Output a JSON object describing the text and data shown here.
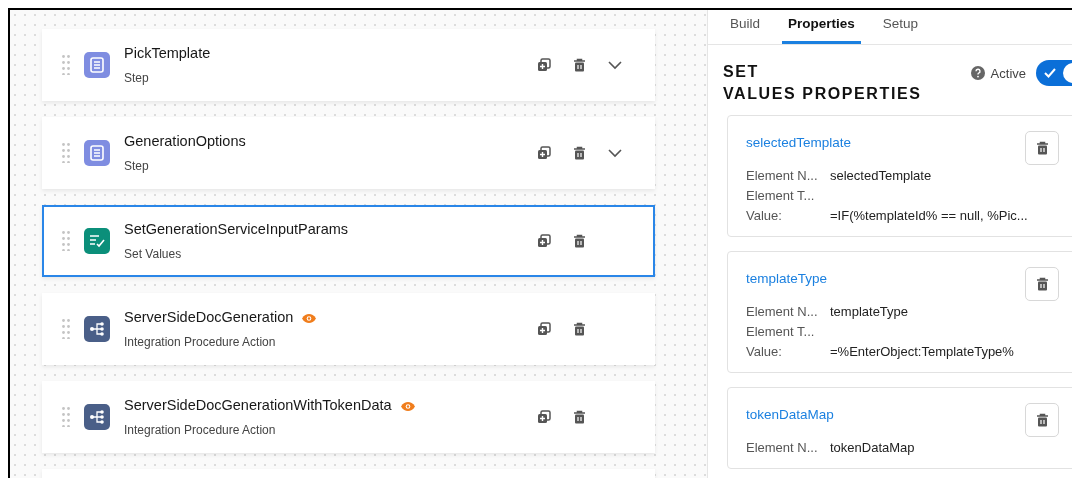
{
  "steps": [
    {
      "kind": "step",
      "title": "PickTemplate",
      "subtitle": "Step",
      "selected": false
    },
    {
      "kind": "step",
      "title": "GenerationOptions",
      "subtitle": "Step",
      "selected": false
    },
    {
      "kind": "set-values",
      "title": "SetGenerationServiceInputParams",
      "subtitle": "Set Values",
      "selected": true
    },
    {
      "kind": "integration-procedure",
      "title": "ServerSideDocGeneration",
      "subtitle": "Integration Procedure Action",
      "selected": false
    },
    {
      "kind": "integration-procedure",
      "title": "ServerSideDocGenerationWithTokenData",
      "subtitle": "Integration Procedure Action",
      "selected": false
    }
  ],
  "tabs": [
    {
      "label": "Build",
      "selected": false
    },
    {
      "label": "Properties",
      "selected": true
    },
    {
      "label": "Setup",
      "selected": false
    }
  ],
  "panel_title": [
    "SET",
    "VALUES PROPERTIES"
  ],
  "active_toggle": {
    "label": "Active",
    "on": true
  },
  "properties": [
    {
      "name": "selectedTemplate",
      "rows": [
        {
          "label": "Element N...",
          "value": "selectedTemplate"
        },
        {
          "label": "Element T..."
        },
        {
          "label": "Value:",
          "value": "=IF(%templateId% == null, %Pic..."
        }
      ]
    },
    {
      "name": "templateType",
      "rows": [
        {
          "label": "Element N...",
          "value": "templateType"
        },
        {
          "label": "Element T..."
        },
        {
          "label": "Value:",
          "value": "=%EnterObject:TemplateType%"
        }
      ]
    },
    {
      "name": "tokenDataMap",
      "rows": [
        {
          "label": "Element N...",
          "value": "tokenDataMap"
        }
      ]
    }
  ]
}
